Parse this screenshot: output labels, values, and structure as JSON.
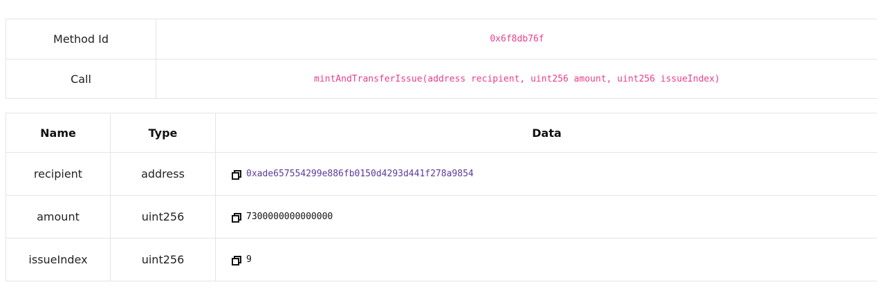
{
  "method": {
    "method_id_label": "Method Id",
    "method_id_value": "0x6f8db76f",
    "call_label": "Call",
    "call_value": "mintAndTransferIssue(address recipient, uint256 amount, uint256 issueIndex)"
  },
  "params": {
    "headers": {
      "name": "Name",
      "type": "Type",
      "data": "Data"
    },
    "rows": [
      {
        "name": "recipient",
        "type": "address",
        "data": "0xade657554299e886fb0150d4293d441f278a9854",
        "is_link": true
      },
      {
        "name": "amount",
        "type": "uint256",
        "data": "7300000000000000",
        "is_link": false
      },
      {
        "name": "issueIndex",
        "type": "uint256",
        "data": "9",
        "is_link": false
      }
    ]
  },
  "icons": {
    "copy": "copy-icon"
  },
  "colors": {
    "method_value": "#e83e8c",
    "address_link": "#5a3a9a",
    "border": "#e4e4e4"
  }
}
